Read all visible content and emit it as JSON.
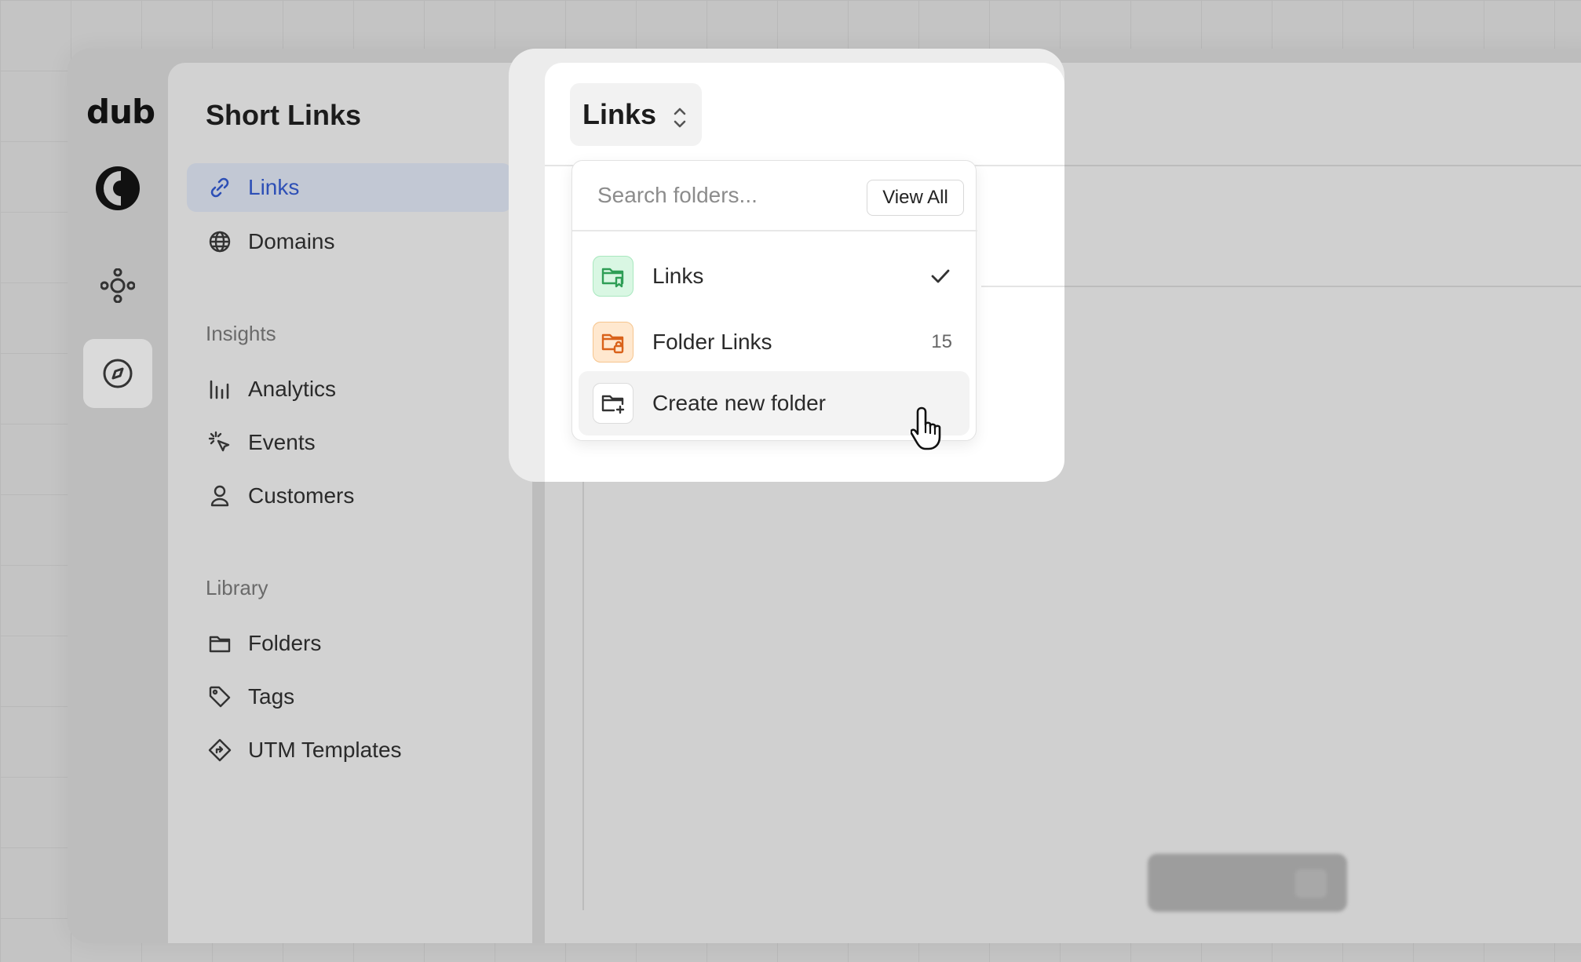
{
  "rail": {
    "logo": "dub",
    "items": [
      {
        "icon": "crescent-logo-icon"
      },
      {
        "icon": "network-icon"
      },
      {
        "icon": "compass-icon",
        "active": true
      }
    ]
  },
  "sidebar": {
    "title": "Short Links",
    "primary": [
      {
        "label": "Links",
        "icon": "link-icon",
        "active": true
      },
      {
        "label": "Domains",
        "icon": "globe-icon"
      }
    ],
    "insights_label": "Insights",
    "insights": [
      {
        "label": "Analytics",
        "icon": "bar-chart-icon"
      },
      {
        "label": "Events",
        "icon": "cursor-rays-icon"
      },
      {
        "label": "Customers",
        "icon": "user-icon"
      }
    ],
    "library_label": "Library",
    "library": [
      {
        "label": "Folders",
        "icon": "folder-icon"
      },
      {
        "label": "Tags",
        "icon": "tag-icon"
      },
      {
        "label": "UTM Templates",
        "icon": "diamond-turn-icon"
      }
    ]
  },
  "folder_switcher": {
    "selected": "Links"
  },
  "dropdown": {
    "search_placeholder": "Search folders...",
    "view_all": "View All",
    "items": [
      {
        "label": "Links",
        "color": "#2f9e56",
        "selected": true
      },
      {
        "label": "Folder Links",
        "color": "#d9621a",
        "count": "15"
      },
      {
        "label": "Create new folder",
        "hover": true
      }
    ]
  },
  "colors": {
    "accent": "#2d4fb6",
    "green_folder": "#2f9e56",
    "orange_folder": "#d9621a"
  }
}
